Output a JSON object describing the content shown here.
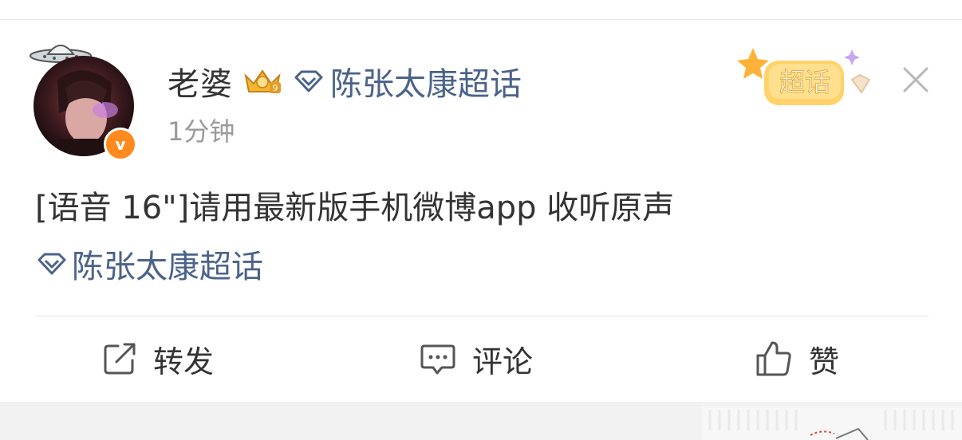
{
  "post": {
    "user_name": "老婆",
    "verified_mark": "v",
    "header_topic": "陈张太康超话",
    "timestamp": "1分钟",
    "text": "[语音 16\"]请用最新版手机微博app 收听原声",
    "topic": "陈张太康超话",
    "sticker_label": "超话"
  },
  "actions": {
    "repost": "转发",
    "comment": "评论",
    "like": "赞"
  },
  "colors": {
    "link": "#4b6389",
    "text": "#333333",
    "muted": "#9a9a9a",
    "verify": "#ff8a1f"
  }
}
